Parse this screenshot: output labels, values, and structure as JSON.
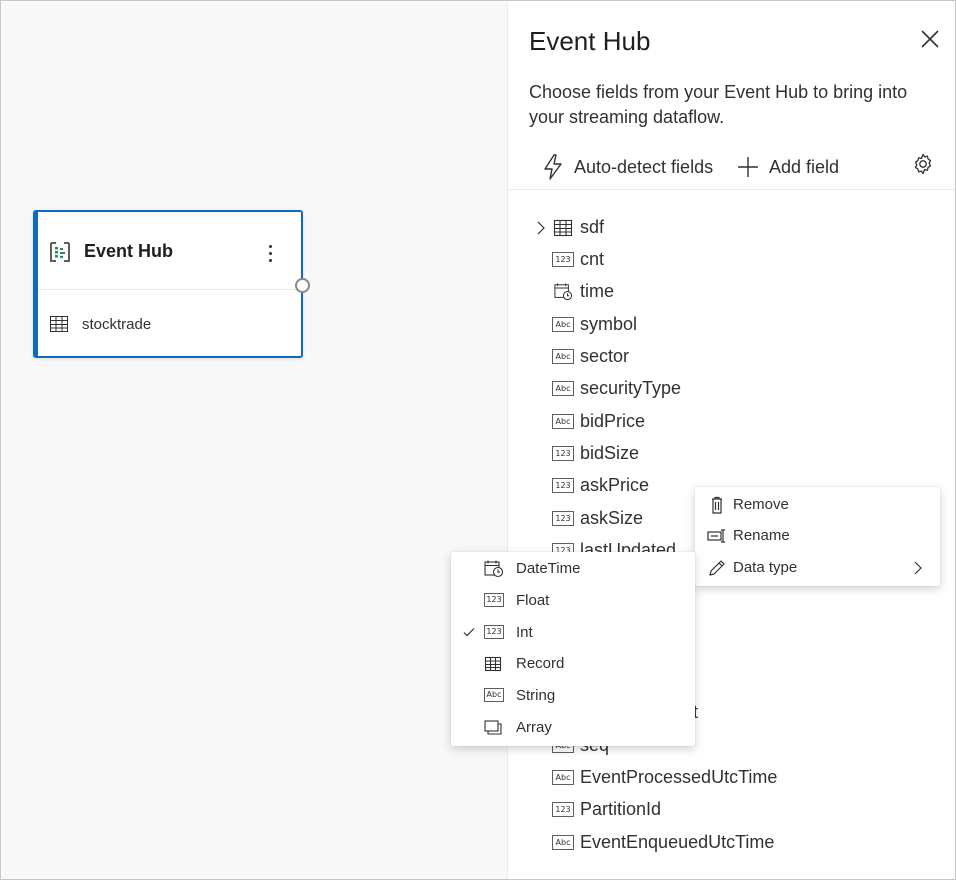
{
  "canvas": {
    "node": {
      "title": "Event Hub",
      "input_label": "stocktrade",
      "accent_color": "#0f6cbd"
    }
  },
  "panel": {
    "title": "Event Hub",
    "description": "Choose fields from your Event Hub to bring into your streaming dataflow.",
    "toolbar": {
      "auto_detect_label": "Auto-detect fields",
      "add_field_label": "Add field"
    },
    "fields": [
      {
        "name": "sdf",
        "type": "record",
        "expandable": true
      },
      {
        "name": "cnt",
        "type": "123"
      },
      {
        "name": "time",
        "type": "datetime"
      },
      {
        "name": "symbol",
        "type": "abc"
      },
      {
        "name": "sector",
        "type": "abc"
      },
      {
        "name": "securityType",
        "type": "abc"
      },
      {
        "name": "bidPrice",
        "type": "abc"
      },
      {
        "name": "bidSize",
        "type": "123"
      },
      {
        "name": "askPrice",
        "type": "123"
      },
      {
        "name": "askSize",
        "type": "123"
      },
      {
        "name": "lastUpdated",
        "type": "123"
      },
      {
        "name": "seq",
        "type": "abc"
      },
      {
        "name": "EventProcessedUtcTime",
        "type": "abc"
      },
      {
        "name": "PartitionId",
        "type": "123"
      },
      {
        "name": "EventEnqueuedUtcTime",
        "type": "abc"
      }
    ],
    "hidden_field_fragment": "t"
  },
  "context_menu": {
    "items": [
      {
        "label": "Remove",
        "icon": "trash-icon"
      },
      {
        "label": "Rename",
        "icon": "rename-icon"
      },
      {
        "label": "Data type",
        "icon": "pencil-icon",
        "has_submenu": true
      }
    ]
  },
  "data_type_menu": {
    "selected": "Int",
    "items": [
      {
        "label": "DateTime",
        "icon": "datetime-icon"
      },
      {
        "label": "Float",
        "icon": "number-icon"
      },
      {
        "label": "Int",
        "icon": "number-icon",
        "checked": true
      },
      {
        "label": "Record",
        "icon": "table-icon"
      },
      {
        "label": "String",
        "icon": "string-icon"
      },
      {
        "label": "Array",
        "icon": "array-icon"
      }
    ]
  },
  "badges": {
    "number": "123",
    "string": "Abc"
  }
}
